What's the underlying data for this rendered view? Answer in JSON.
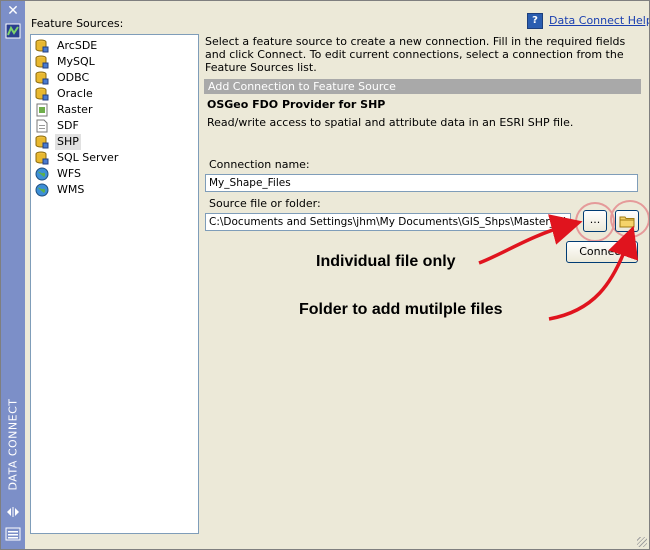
{
  "strip": {
    "close_glyph": "✕",
    "label": "DATA CONNECT"
  },
  "sources": {
    "label": "Feature Sources:",
    "selected": "SHP",
    "items": [
      {
        "label": "ArcSDE",
        "icon": "database-icon"
      },
      {
        "label": "MySQL",
        "icon": "database-icon"
      },
      {
        "label": "ODBC",
        "icon": "database-icon"
      },
      {
        "label": "Oracle",
        "icon": "database-icon"
      },
      {
        "label": "Raster",
        "icon": "raster-file-icon"
      },
      {
        "label": "SDF",
        "icon": "file-icon"
      },
      {
        "label": "SHP",
        "icon": "database-icon"
      },
      {
        "label": "SQL Server",
        "icon": "database-icon"
      },
      {
        "label": "WFS",
        "icon": "globe-icon"
      },
      {
        "label": "WMS",
        "icon": "globe-icon"
      }
    ]
  },
  "help": {
    "icon_glyph": "?",
    "link": "Data Connect Help"
  },
  "instructions": "Select a feature source to create a new connection. Fill in the required fields and click Connect. To edit current connections, select a connection from the Feature Sources list.",
  "section": {
    "header": "Add Connection to Feature Source",
    "provider": "OSGeo FDO Provider for SHP",
    "description": "Read/write access to spatial and attribute data in an ESRI SHP file."
  },
  "form": {
    "connection_name_label": "Connection name:",
    "connection_name_value": "My_Shape_Files",
    "source_label": "Source file or folder:",
    "source_value": "C:\\Documents and Settings\\jhm\\My Documents\\GIS_Shps\\Master_Files",
    "browse_file_glyph": "...",
    "connect_label": "Connect"
  },
  "annotations": {
    "file_note": "Individual file only",
    "folder_note": "Folder to add mutilple files",
    "arrow_color": "#e0141e"
  },
  "colors": {
    "strip": "#7c8fc8",
    "section_header": "#a9a9a9",
    "link": "#1a3fb0"
  }
}
